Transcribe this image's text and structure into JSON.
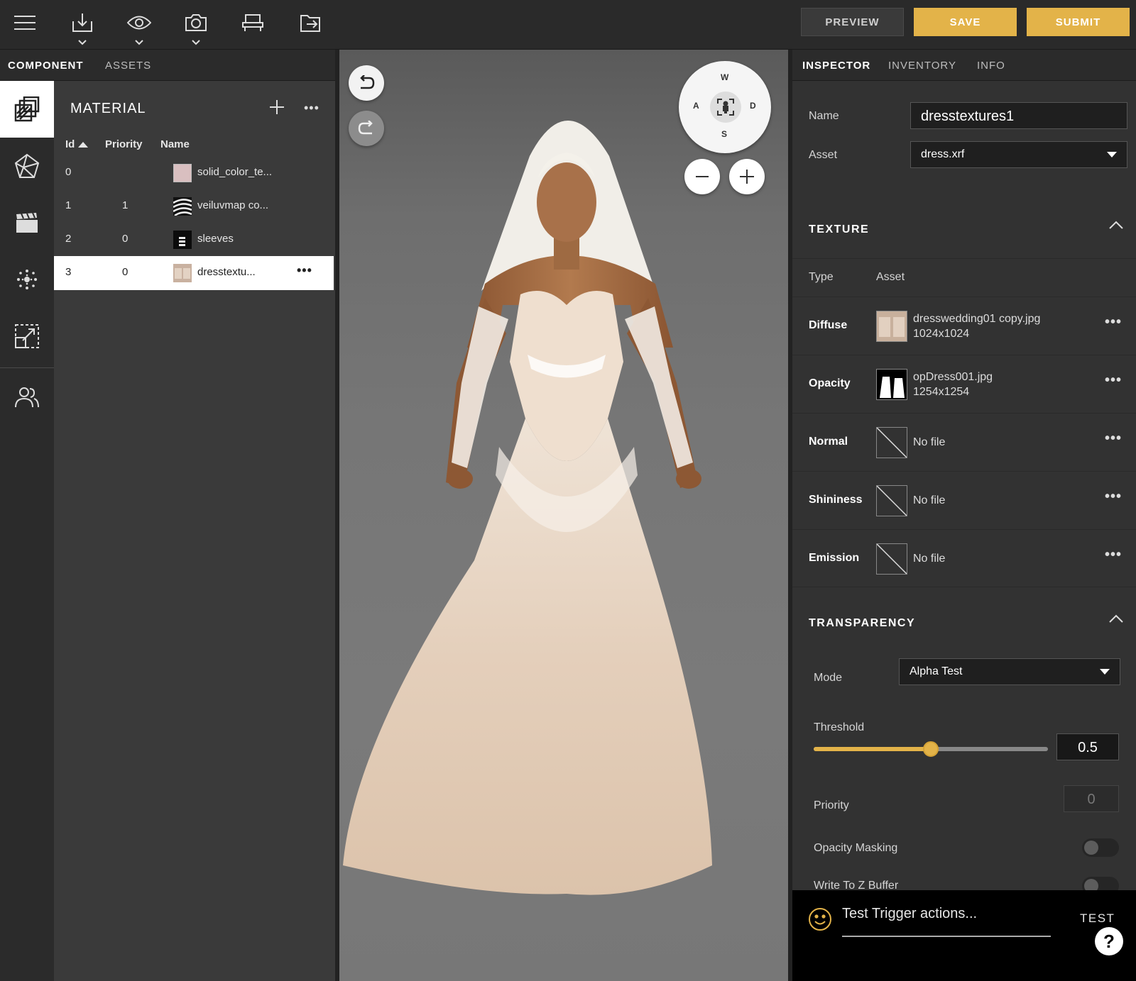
{
  "toolbar": {
    "preview_label": "PREVIEW",
    "save_label": "SAVE",
    "submit_label": "SUBMIT",
    "icons": [
      "menu-icon",
      "download-icon",
      "eye-icon",
      "camera-icon",
      "chair-icon",
      "export-icon"
    ]
  },
  "left_tabs": {
    "component": "COMPONENT",
    "assets": "ASSETS"
  },
  "material": {
    "title": "MATERIAL",
    "columns": {
      "id": "Id",
      "priority": "Priority",
      "name": "Name"
    },
    "rows": [
      {
        "id": "0",
        "priority": "",
        "name": "solid_color_te...",
        "swatch": "#d9bfc0"
      },
      {
        "id": "1",
        "priority": "1",
        "name": "veiluvmap co..."
      },
      {
        "id": "2",
        "priority": "0",
        "name": "sleeves"
      },
      {
        "id": "3",
        "priority": "0",
        "name": "dresstextu...",
        "selected": true
      }
    ]
  },
  "viewport": {
    "compass": {
      "w": "W",
      "a": "A",
      "d": "D",
      "s": "S"
    }
  },
  "inspector": {
    "tabs": {
      "inspector": "INSPECTOR",
      "inventory": "INVENTORY",
      "info": "INFO"
    },
    "name_label": "Name",
    "name_value": "dresstextures1",
    "asset_label": "Asset",
    "asset_value": "dress.xrf",
    "texture": {
      "title": "TEXTURE",
      "type_header": "Type",
      "asset_header": "Asset",
      "rows": [
        {
          "type": "Diffuse",
          "file": "dresswedding01 copy.jpg",
          "size": "1024x1024"
        },
        {
          "type": "Opacity",
          "file": "opDress001.jpg",
          "size": "1254x1254"
        },
        {
          "type": "Normal",
          "file": "No file",
          "size": ""
        },
        {
          "type": "Shininess",
          "file": "No file",
          "size": ""
        },
        {
          "type": "Emission",
          "file": "No file",
          "size": ""
        }
      ]
    },
    "transparency": {
      "title": "TRANSPARENCY",
      "mode_label": "Mode",
      "mode_value": "Alpha Test",
      "threshold_label": "Threshold",
      "threshold_value": "0.5",
      "threshold_fraction": 0.5,
      "priority_label": "Priority",
      "priority_value": "0",
      "opacity_masking_label": "Opacity Masking",
      "opacity_masking_on": false,
      "write_z_label": "Write To Z Buffer",
      "write_z_on": false
    }
  },
  "trigger": {
    "placeholder": "Test Trigger actions...",
    "test_label": "TEST",
    "help": "?"
  },
  "colors": {
    "accent": "#e3b349",
    "panel": "#3a3a3a",
    "topbar": "#2a2a2a"
  }
}
